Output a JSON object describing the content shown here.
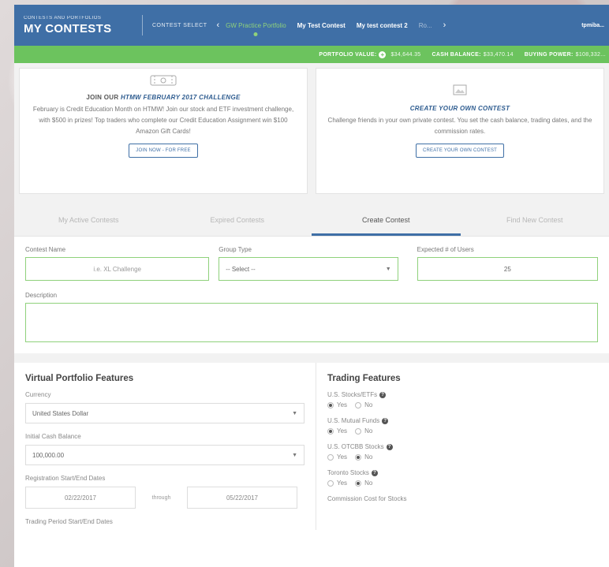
{
  "header": {
    "brand_small": "CONTESTS AND PORTFOLIOS",
    "brand_title": "MY CONTESTS",
    "contest_select_label": "CONTEST SELECT",
    "prev_icon": "chevron-left-icon",
    "next_icon": "chevron-right-icon",
    "contests": [
      {
        "label": "GW Practice Portfolio"
      },
      {
        "label": "My Test Contest"
      },
      {
        "label": "My test contest 2"
      },
      {
        "label": "Ro..."
      }
    ],
    "user": "tpmiba..."
  },
  "portfolio_bar": {
    "portfolio_value_label": "PORTFOLIO VALUE:",
    "portfolio_value": "$34,644.35",
    "cash_balance_label": "CASH BALANCE:",
    "cash_balance": "$33,470.14",
    "buying_power_label": "BUYING POWER:",
    "buying_power": "$108,332..."
  },
  "promos": {
    "left": {
      "icon": "ticket-icon",
      "title_prefix": "JOIN OUR",
      "title_emph": "HTMW FEBRUARY 2017 CHALLENGE",
      "body": "February is Credit Education Month on HTMW! Join our stock and ETF investment challenge, with $500 in prizes! Top traders who complete our Credit Education Assignment win $100 Amazon Gift Cards!",
      "button": "JOIN NOW - FOR FREE"
    },
    "right": {
      "icon": "image-icon",
      "title": "CREATE YOUR OWN CONTEST",
      "body": "Challenge friends in your own private contest. You set the cash balance, trading dates, and the commission rates.",
      "button": "CREATE YOUR OWN CONTEST"
    }
  },
  "tabs": [
    {
      "label": "My Active Contests"
    },
    {
      "label": "Expired Contests"
    },
    {
      "label": "Create Contest"
    },
    {
      "label": "Find New Contest"
    }
  ],
  "form": {
    "contest_name_label": "Contest Name",
    "contest_name_placeholder": "i.e. XL Challenge",
    "group_type_label": "Group Type",
    "group_type_value": "-- Select --",
    "expected_users_label": "Expected # of Users",
    "expected_users_value": "25",
    "description_label": "Description"
  },
  "virtual_portfolio": {
    "title": "Virtual Portfolio Features",
    "currency_label": "Currency",
    "currency_value": "United States Dollar",
    "cash_label": "Initial Cash Balance",
    "cash_value": "100,000.00",
    "registration_label": "Registration Start/End Dates",
    "registration_start": "02/22/2017",
    "through": "through",
    "registration_end": "05/22/2017",
    "trading_label": "Trading Period Start/End Dates"
  },
  "trading_features": {
    "title": "Trading Features",
    "yes": "Yes",
    "no": "No",
    "items": [
      {
        "label": "U.S. Stocks/ETFs"
      },
      {
        "label": "U.S. Mutual Funds"
      },
      {
        "label": "U.S. OTCBB Stocks"
      },
      {
        "label": "Toronto Stocks"
      }
    ],
    "commission_label": "Commission Cost for Stocks"
  }
}
